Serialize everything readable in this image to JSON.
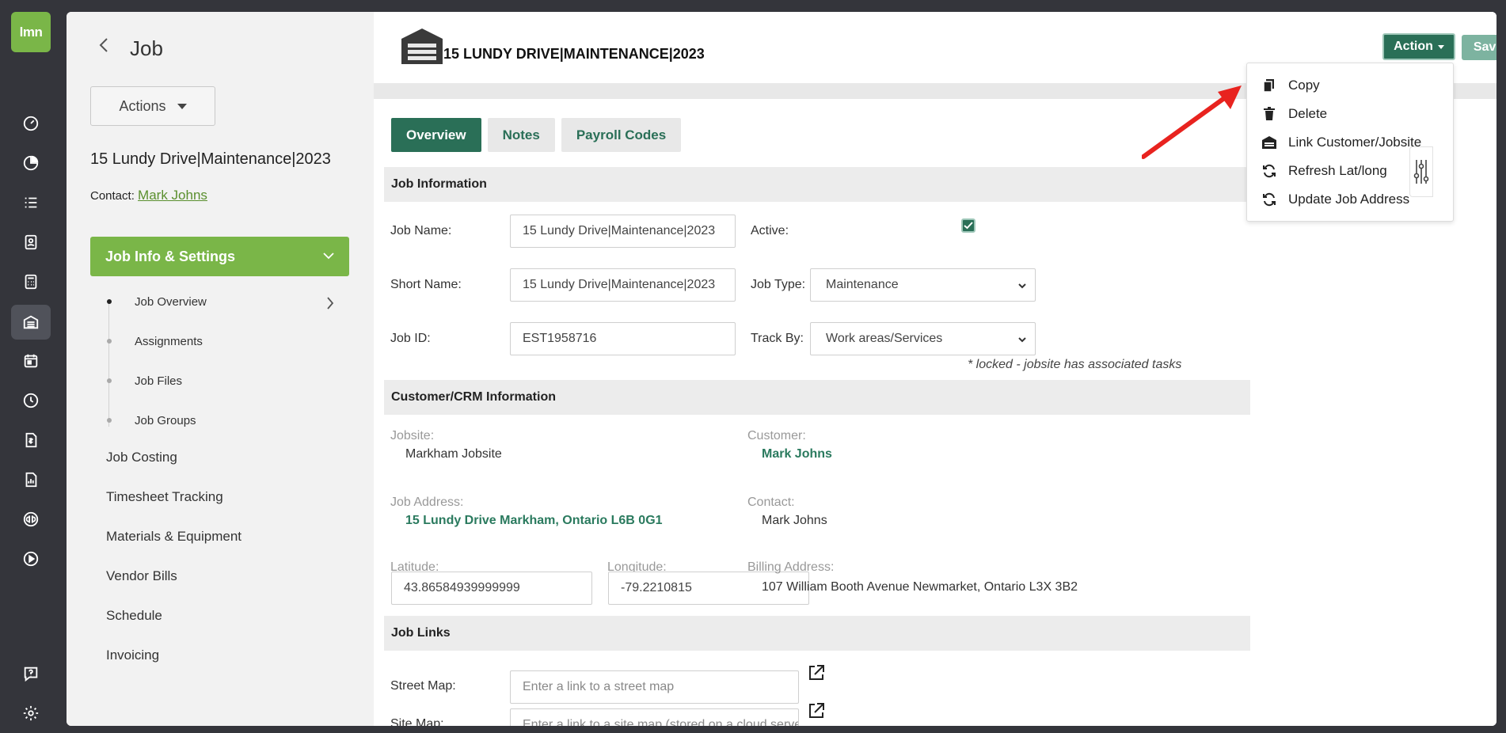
{
  "rail": {
    "logo": "lmn"
  },
  "sidebar": {
    "title": "Job",
    "actions_label": "Actions",
    "job_name": "15 Lundy Drive|Maintenance|2023",
    "contact_label": "Contact:",
    "contact_name": "Mark Johns",
    "active_section": "Job Info & Settings",
    "sub_items": [
      "Job Overview",
      "Assignments",
      "Job Files",
      "Job Groups"
    ],
    "links": [
      "Job Costing",
      "Timesheet Tracking",
      "Materials & Equipment",
      "Vendor Bills",
      "Schedule",
      "Invoicing"
    ]
  },
  "header": {
    "job_title": "15 LUNDY DRIVE|MAINTENANCE|2023",
    "action_label": "Action",
    "save_label": "Save"
  },
  "action_menu": {
    "items": [
      "Copy",
      "Delete",
      "Link Customer/Jobsite",
      "Refresh Lat/long",
      "Update Job Address"
    ]
  },
  "tabs": [
    "Overview",
    "Notes",
    "Payroll Codes"
  ],
  "job_info": {
    "header": "Job Information",
    "job_name_label": "Job Name:",
    "job_name_value": "15 Lundy Drive|Maintenance|2023",
    "active_label": "Active:",
    "short_name_label": "Short Name:",
    "short_name_value": "15 Lundy Drive|Maintenance|2023",
    "job_type_label": "Job Type:",
    "job_type_value": "Maintenance",
    "job_id_label": "Job ID:",
    "job_id_value": "EST1958716",
    "track_by_label": "Track By:",
    "track_by_value": "Work areas/Services",
    "track_note": "* locked - jobsite has associated tasks"
  },
  "crm": {
    "header": "Customer/CRM Information",
    "jobsite_label": "Jobsite:",
    "jobsite_value": "Markham Jobsite",
    "customer_label": "Customer:",
    "customer_value": "Mark Johns",
    "address_label": "Job Address:",
    "address_value": "15 Lundy Drive Markham, Ontario L6B 0G1",
    "contact_label": "Contact:",
    "contact_value": "Mark Johns",
    "latitude_label": "Latitude:",
    "latitude_value": "43.86584939999999",
    "longitude_label": "Longitude:",
    "longitude_value": "-79.2210815",
    "billing_label": "Billing Address:",
    "billing_value": "107 William Booth Avenue Newmarket, Ontario L3X 3B2"
  },
  "links": {
    "header": "Job Links",
    "street_label": "Street Map:",
    "street_placeholder": "Enter a link to a street map",
    "site_label": "Site Map:",
    "site_placeholder": "Enter a link to a site map (stored on a cloud server such"
  },
  "colors": {
    "brand_green": "#7ab648",
    "dark_green": "#2a6f57",
    "rail_bg": "#34353b"
  }
}
